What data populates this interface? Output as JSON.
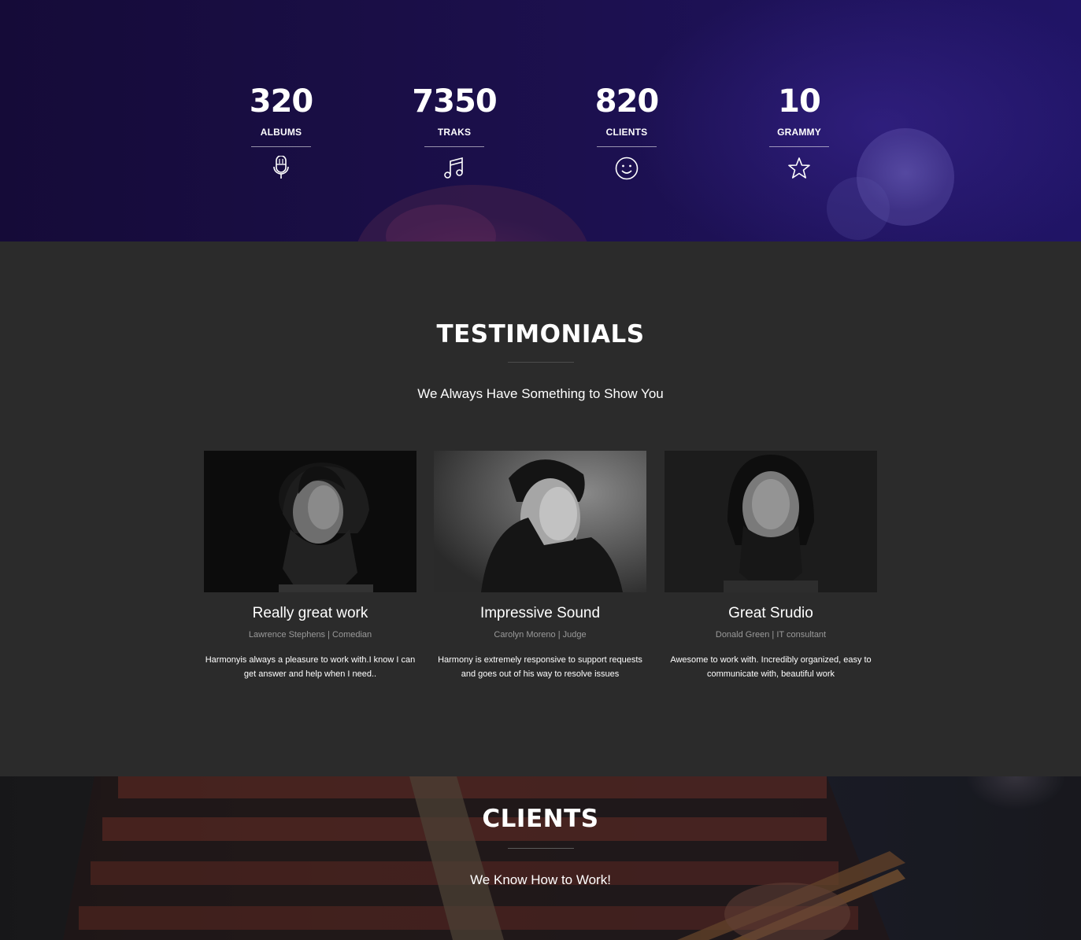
{
  "counters": [
    {
      "value": "320",
      "label": "ALBUMS",
      "icon": "microphone-icon"
    },
    {
      "value": "7350",
      "label": "TRAKS",
      "icon": "music-note-icon"
    },
    {
      "value": "820",
      "label": "CLIENTS",
      "icon": "smiley-icon"
    },
    {
      "value": "10",
      "label": "GRAMMY",
      "icon": "star-icon"
    }
  ],
  "testimonials": {
    "title": "TESTIMONIALS",
    "subtitle": "We Always Have Something to Show You",
    "items": [
      {
        "title": "Really great work",
        "author": "Lawrence Stephens | Comedian",
        "quote": "Harmonyis always a pleasure to work with.I know I can get answer and help when I need.."
      },
      {
        "title": "Impressive Sound",
        "author": "Carolyn Moreno | Judge",
        "quote": "Harmony is extremely responsive to support requests and goes out of his way to resolve issues"
      },
      {
        "title": "Great Srudio",
        "author": "Donald Green | IT consultant",
        "quote": "Awesome to work with. Incredibly organized, easy to communicate with, beautiful work"
      }
    ]
  },
  "clients": {
    "title": "CLIENTS",
    "subtitle": "We Know How to Work!"
  },
  "colors": {
    "counter_bg": "#1b0f4a",
    "section_bg": "#2b2b2b",
    "muted_text": "#9a9a9a"
  }
}
